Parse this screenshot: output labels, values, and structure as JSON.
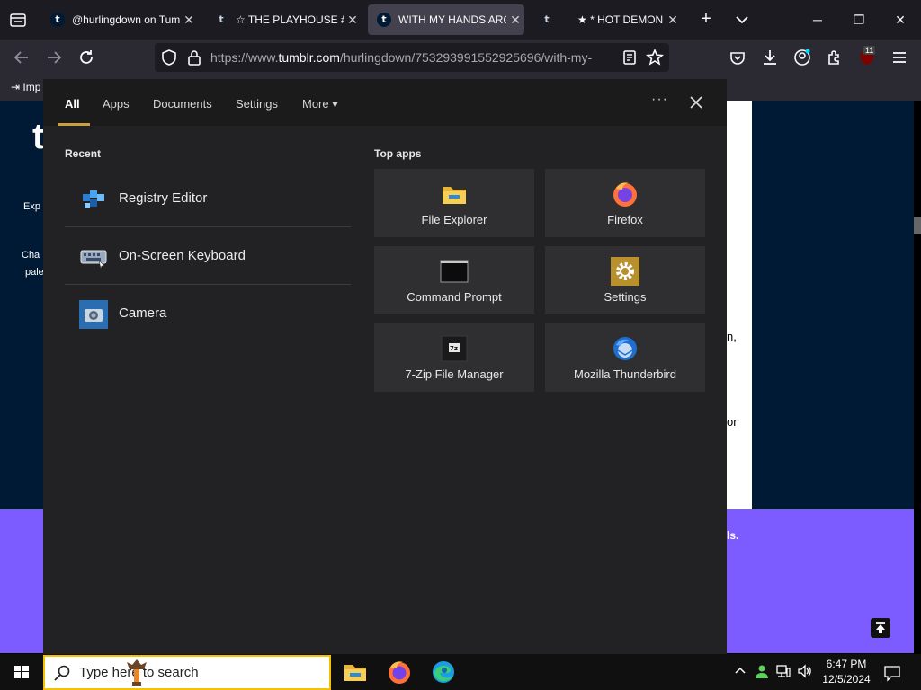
{
  "browser": {
    "tabs": [
      {
        "favicon": "t",
        "title": "@hurlingdown on Tum",
        "active": false
      },
      {
        "favicon": "t",
        "title": "☆ THE PLAYHOUSE # y",
        "active": false
      },
      {
        "favicon": "t",
        "title": "WITH MY HANDS ARO",
        "active": true
      },
      {
        "favicon": "t",
        "title": "",
        "active": false
      },
      {
        "favicon": "",
        "title": "★ * HOT DEMON E",
        "active": false
      }
    ],
    "url_prefix": "https://www.",
    "url_domain": "tumblr.com",
    "url_path": "/hurlingdown/753293991552925696/with-my-",
    "bookmark_label": "Imp",
    "extension_badge": "11"
  },
  "page_peek": {
    "left_text_1": "Exp",
    "left_text_2": "Cha",
    "left_text_3": "pale",
    "right_text_1": "n,",
    "right_text_2": "or",
    "right_text_3": "ls."
  },
  "search_flyout": {
    "tabs": [
      {
        "label": "All",
        "selected": true
      },
      {
        "label": "Apps",
        "selected": false
      },
      {
        "label": "Documents",
        "selected": false
      },
      {
        "label": "Settings",
        "selected": false
      },
      {
        "label": "More",
        "selected": false
      }
    ],
    "more_options": "···",
    "recent_title": "Recent",
    "recent": [
      {
        "label": "Registry Editor",
        "icon": "registry-editor-icon"
      },
      {
        "label": "On-Screen Keyboard",
        "icon": "onscreen-keyboard-icon"
      },
      {
        "label": "Camera",
        "icon": "camera-icon"
      }
    ],
    "top_apps_title": "Top apps",
    "top_apps": [
      {
        "label": "File Explorer",
        "icon": "file-explorer-icon"
      },
      {
        "label": "Firefox",
        "icon": "firefox-icon"
      },
      {
        "label": "Command Prompt",
        "icon": "command-prompt-icon"
      },
      {
        "label": "Settings",
        "icon": "settings-gear-icon"
      },
      {
        "label": "7-Zip File Manager",
        "icon": "7zip-icon"
      },
      {
        "label": "Mozilla Thunderbird",
        "icon": "thunderbird-icon"
      }
    ]
  },
  "taskbar": {
    "search_placeholder": "Type here to search",
    "pinned": [
      "file-explorer-icon",
      "firefox-icon",
      "edge-icon"
    ],
    "clock_time": "6:47 PM",
    "clock_date": "12/5/2024"
  },
  "colors": {
    "accent_underline": "#c8a040",
    "searchbox_border": "#f2c400",
    "page_purple": "#7c5cff",
    "tumblr_navy": "#001935"
  }
}
